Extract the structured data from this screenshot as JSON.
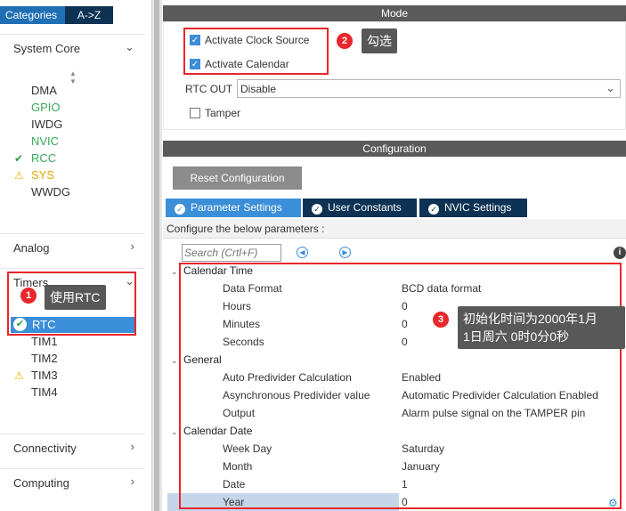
{
  "sidebar": {
    "tabs": {
      "categories": "Categories",
      "az": "A->Z"
    },
    "system_core": {
      "label": "System Core",
      "items": [
        {
          "label": "DMA",
          "state": "none"
        },
        {
          "label": "GPIO",
          "state": "configured"
        },
        {
          "label": "IWDG",
          "state": "none"
        },
        {
          "label": "NVIC",
          "state": "configured"
        },
        {
          "label": "RCC",
          "state": "ok"
        },
        {
          "label": "SYS",
          "state": "warning"
        },
        {
          "label": "WWDG",
          "state": "none"
        }
      ]
    },
    "analog": {
      "label": "Analog"
    },
    "timers": {
      "label": "Timers",
      "items": [
        {
          "label": "RTC",
          "state": "selected"
        },
        {
          "label": "TIM1",
          "state": "none"
        },
        {
          "label": "TIM2",
          "state": "none"
        },
        {
          "label": "TIM3",
          "state": "warning"
        },
        {
          "label": "TIM4",
          "state": "none"
        }
      ]
    },
    "connectivity": {
      "label": "Connectivity"
    },
    "computing": {
      "label": "Computing"
    }
  },
  "mode": {
    "title": "Mode",
    "activate_clock_source": {
      "label": "Activate Clock Source",
      "checked": true
    },
    "activate_calendar": {
      "label": "Activate Calendar",
      "checked": true
    },
    "rtc_out": {
      "label": "RTC OUT",
      "value": "Disable"
    },
    "tamper": {
      "label": "Tamper",
      "checked": false
    }
  },
  "configuration": {
    "title": "Configuration",
    "reset_label": "Reset Configuration",
    "tabs": [
      {
        "label": "Parameter Settings",
        "active": true
      },
      {
        "label": "User Constants",
        "active": false
      },
      {
        "label": "NVIC Settings",
        "active": false
      }
    ],
    "info": "Configure the below parameters :",
    "search_placeholder": "Search (Crtl+F)",
    "groups": {
      "calendar_time": {
        "title": "Calendar Time",
        "params": [
          {
            "name": "Data Format",
            "value": "BCD data format"
          },
          {
            "name": "Hours",
            "value": "0"
          },
          {
            "name": "Minutes",
            "value": "0"
          },
          {
            "name": "Seconds",
            "value": "0"
          }
        ]
      },
      "general": {
        "title": "General",
        "params": [
          {
            "name": "Auto Predivider Calculation",
            "value": "Enabled"
          },
          {
            "name": "Asynchronous Predivider value",
            "value": "Automatic Predivider Calculation Enabled"
          },
          {
            "name": "Output",
            "value": "Alarm pulse signal on the TAMPER pin"
          }
        ]
      },
      "calendar_date": {
        "title": "Calendar Date",
        "params": [
          {
            "name": "Week Day",
            "value": "Saturday"
          },
          {
            "name": "Month",
            "value": "January"
          },
          {
            "name": "Date",
            "value": "1"
          },
          {
            "name": "Year",
            "value": "0"
          }
        ]
      }
    }
  },
  "annotations": [
    {
      "number": "1",
      "text": "使用RTC"
    },
    {
      "number": "2",
      "text": "勾选"
    },
    {
      "number": "3",
      "line1": "初始化时间为2000年1月",
      "line2": "1日周六 0时0分0秒"
    }
  ],
  "colors": {
    "accent": "#3b8ed8",
    "navy": "#0d3253",
    "highlight": "#e8262b",
    "tooltip": "#585858"
  }
}
